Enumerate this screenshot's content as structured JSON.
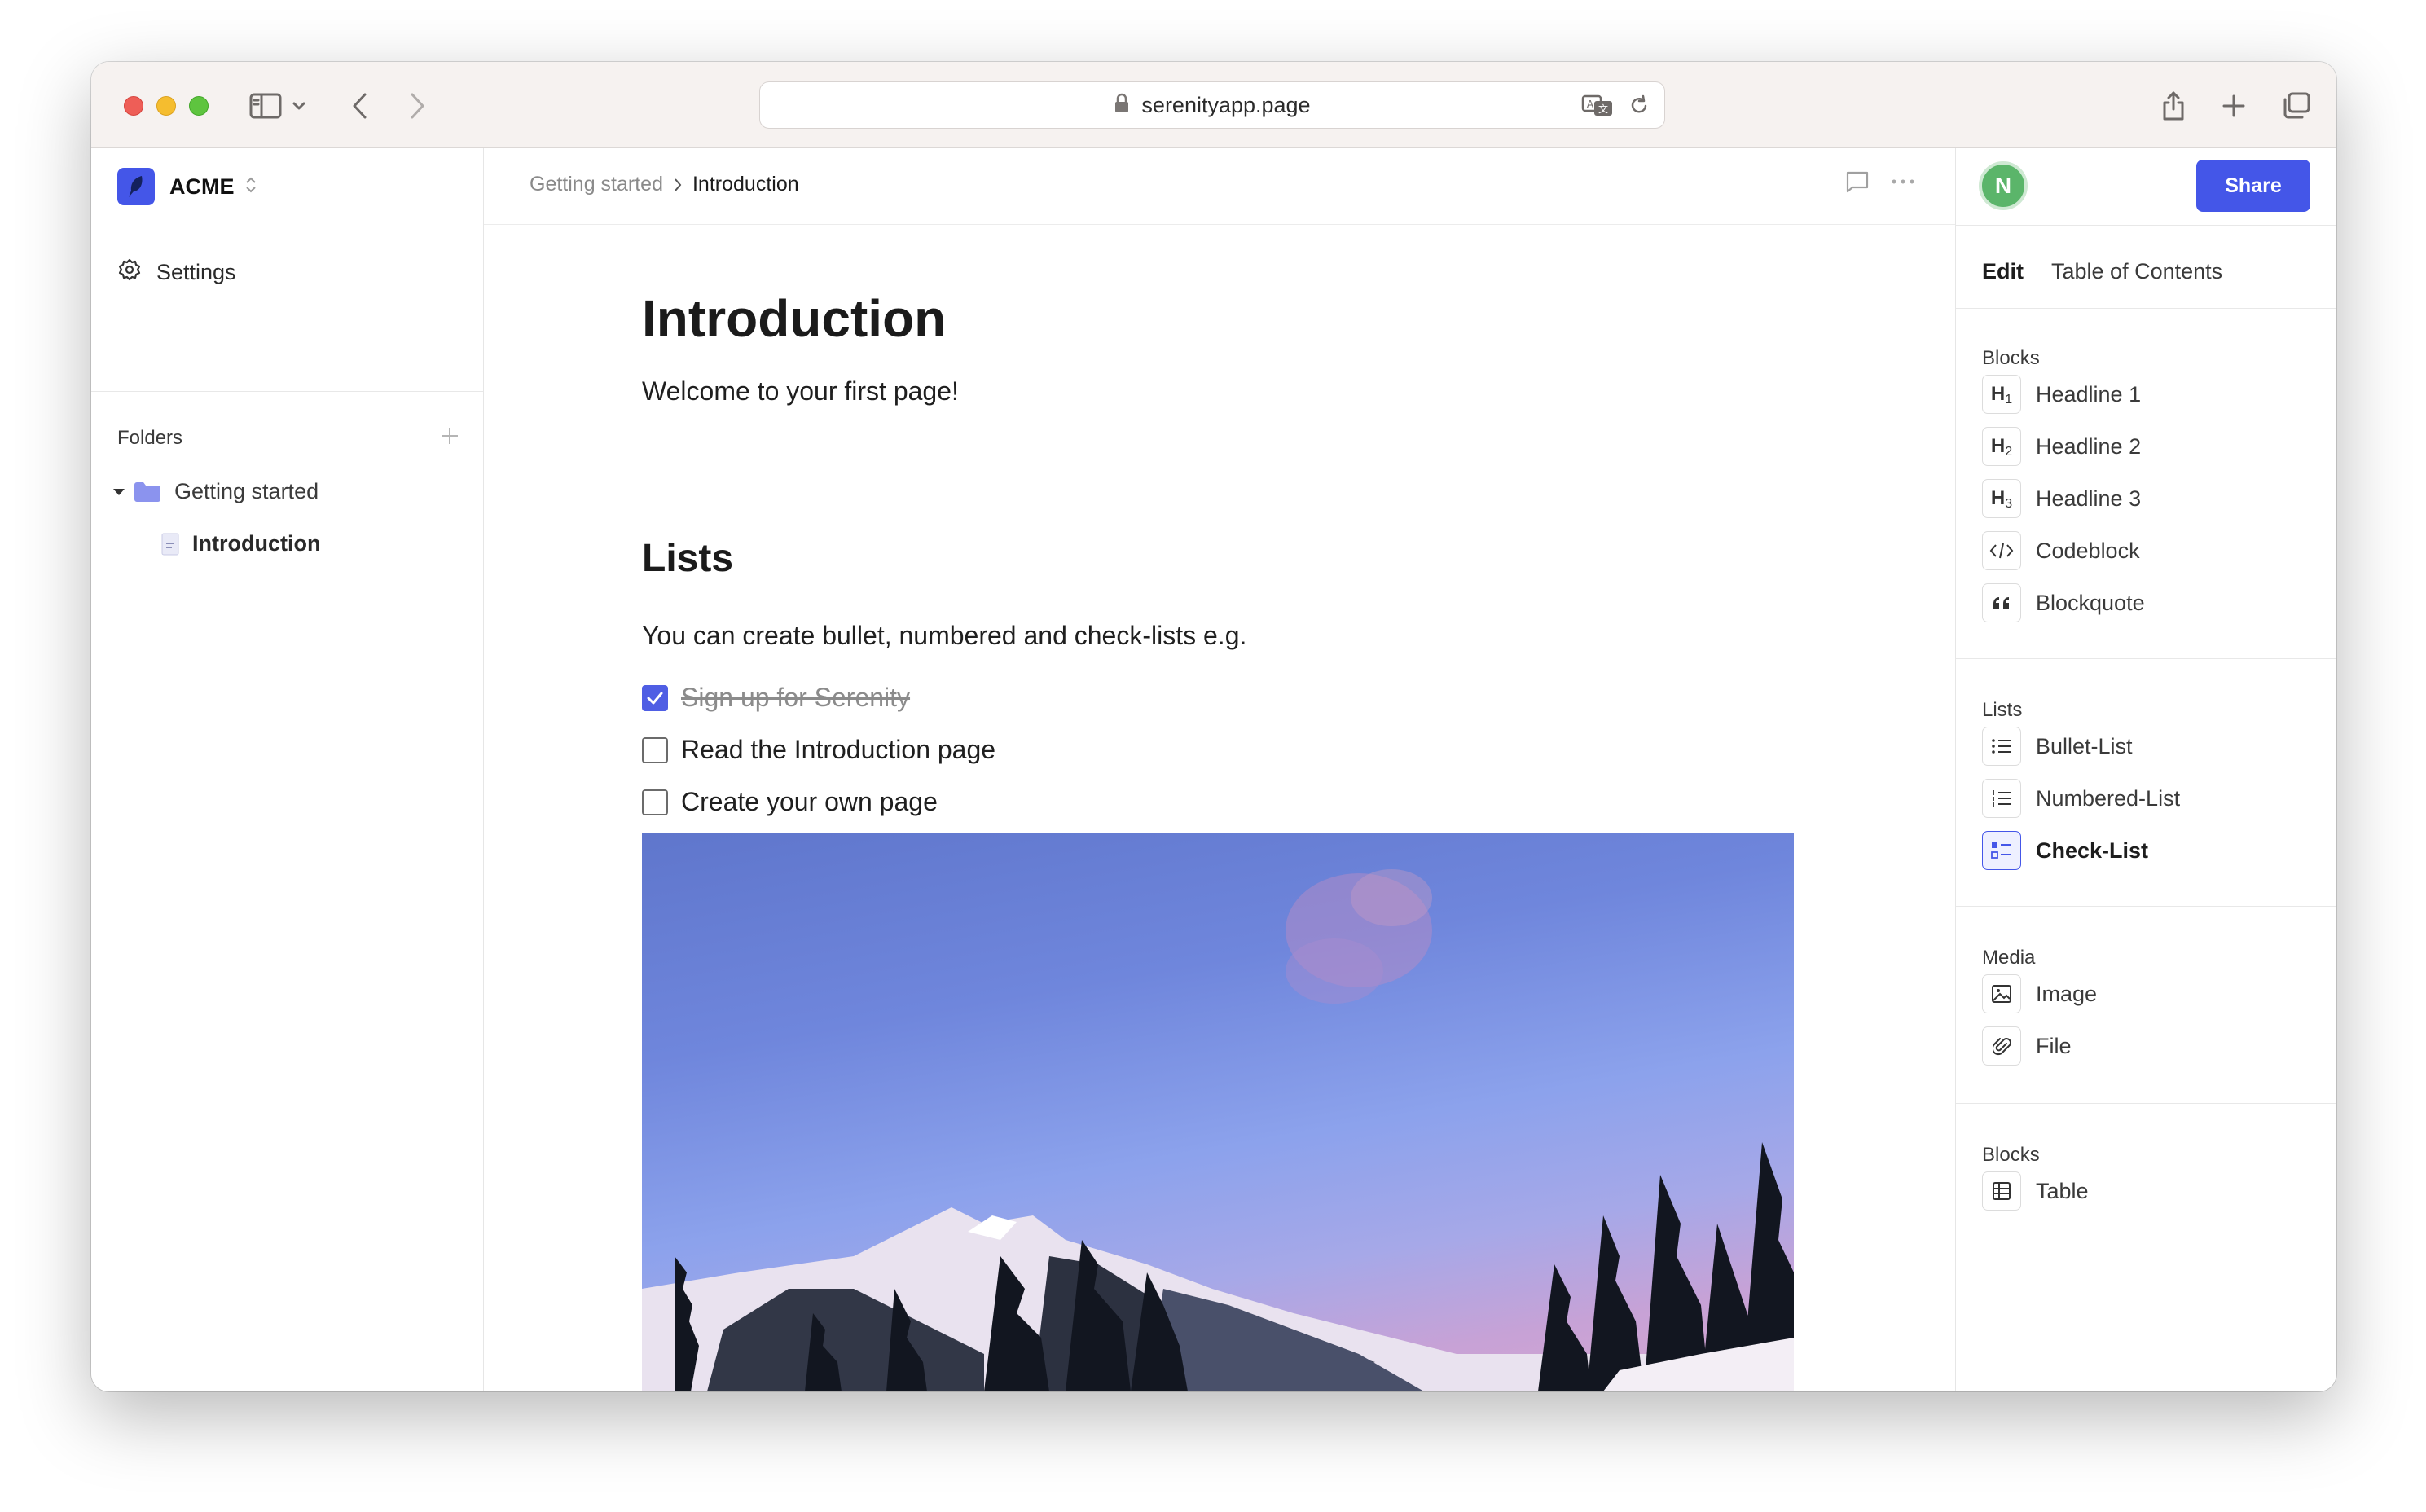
{
  "browser": {
    "url": "serenityapp.page"
  },
  "sidebar": {
    "workspace_name": "ACME",
    "settings_label": "Settings",
    "folders_label": "Folders",
    "folder_name": "Getting started",
    "page_name": "Introduction"
  },
  "breadcrumb": {
    "parent": "Getting started",
    "current": "Introduction"
  },
  "document": {
    "title": "Introduction",
    "intro": "Welcome to your first page!",
    "section_title": "Lists",
    "section_text": "You can create bullet, numbered and check-lists e.g.",
    "checklist": [
      {
        "text": "Sign up for Serenity",
        "checked": true
      },
      {
        "text": "Read the Introduction page",
        "checked": false
      },
      {
        "text": "Create your own page",
        "checked": false
      }
    ]
  },
  "right_panel": {
    "avatar_initial": "N",
    "share_label": "Share",
    "tabs": [
      "Edit",
      "Table of Contents"
    ],
    "sections": [
      {
        "label": "Blocks",
        "items": [
          {
            "label": "Headline 1",
            "icon": "h1-icon"
          },
          {
            "label": "Headline 2",
            "icon": "h2-icon"
          },
          {
            "label": "Headline 3",
            "icon": "h3-icon"
          },
          {
            "label": "Codeblock",
            "icon": "code-icon"
          },
          {
            "label": "Blockquote",
            "icon": "quote-icon"
          }
        ]
      },
      {
        "label": "Lists",
        "items": [
          {
            "label": "Bullet-List",
            "icon": "bullet-list-icon"
          },
          {
            "label": "Numbered-List",
            "icon": "numbered-list-icon"
          },
          {
            "label": "Check-List",
            "icon": "check-list-icon",
            "active": true
          }
        ]
      },
      {
        "label": "Media",
        "items": [
          {
            "label": "Image",
            "icon": "image-icon"
          },
          {
            "label": "File",
            "icon": "paperclip-icon"
          }
        ]
      },
      {
        "label": "Blocks",
        "items": [
          {
            "label": "Table",
            "icon": "table-icon"
          }
        ]
      }
    ]
  },
  "colors": {
    "accent": "#4456e8",
    "checkbox_checked": "#4f5ee4",
    "avatar": "#5bb56a"
  }
}
